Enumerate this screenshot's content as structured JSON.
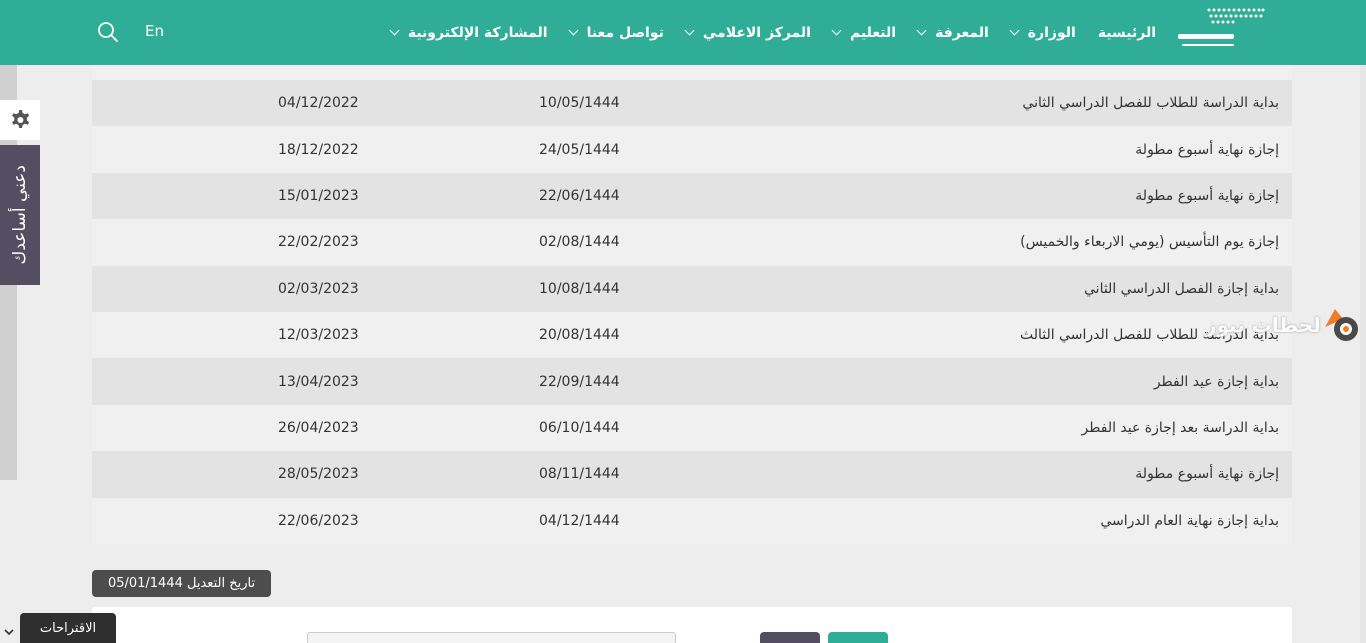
{
  "nav": {
    "items": [
      {
        "label": "الرئيسية",
        "has_dropdown": false
      },
      {
        "label": "الوزارة",
        "has_dropdown": true
      },
      {
        "label": "المعرفة",
        "has_dropdown": true
      },
      {
        "label": "التعليم",
        "has_dropdown": true
      },
      {
        "label": "المركز الاعلامي",
        "has_dropdown": true
      },
      {
        "label": "تواصل معنا",
        "has_dropdown": true
      },
      {
        "label": "المشاركة الإلكترونية",
        "has_dropdown": true
      }
    ],
    "language": "En"
  },
  "sidebar": {
    "help_label": "دعني أساعدك"
  },
  "calendar": {
    "rows": [
      {
        "event": "بداية الدراسة للطلاب للفصل الدراسي الثاني",
        "hijri": "10/05/1444",
        "gregorian": "04/12/2022"
      },
      {
        "event": "إجازة نهاية أسبوع مطولة",
        "hijri": "24/05/1444",
        "gregorian": "18/12/2022"
      },
      {
        "event": "إجازة نهاية أسبوع مطولة",
        "hijri": "22/06/1444",
        "gregorian": "15/01/2023"
      },
      {
        "event": "إجازة يوم التأسيس (يومي الاربعاء والخميس)",
        "hijri": "02/08/1444",
        "gregorian": "22/02/2023"
      },
      {
        "event": "بداية إجازة الفصل الدراسي الثاني",
        "hijri": "10/08/1444",
        "gregorian": "02/03/2023"
      },
      {
        "event": "بداية الدراسة للطلاب للفصل الدراسي الثالث",
        "hijri": "20/08/1444",
        "gregorian": "12/03/2023"
      },
      {
        "event": "بداية إجازة عيد الفطر",
        "hijri": "22/09/1444",
        "gregorian": "13/04/2023"
      },
      {
        "event": "بداية الدراسة بعد إجازة عيد الفطر",
        "hijri": "06/10/1444",
        "gregorian": "26/04/2023"
      },
      {
        "event": "إجازة نهاية أسبوع مطولة",
        "hijri": "08/11/1444",
        "gregorian": "28/05/2023"
      },
      {
        "event": "بداية إجازة نهاية العام الدراسي",
        "hijri": "04/12/1444",
        "gregorian": "22/06/2023"
      }
    ]
  },
  "modified_date": "تاريخ التعديل 05/01/1444",
  "suggestions_label": "الاقتراحات",
  "watermark": "لحظات نيوز",
  "colors": {
    "brand": "#30ad97",
    "help_tab": "#544e63"
  }
}
